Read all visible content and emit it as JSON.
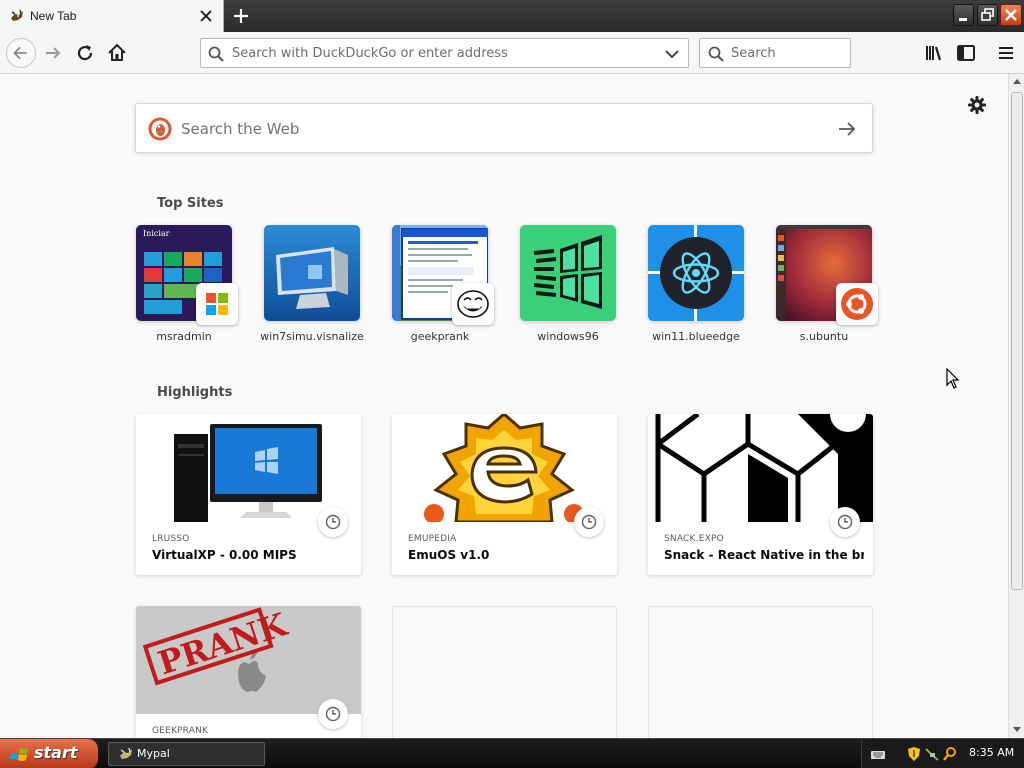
{
  "colors": {
    "accent": "#0a84ff",
    "titlebar": "#2a2a2a",
    "close_button": "#c4411b",
    "start_button": "#d2532d"
  },
  "tab": {
    "title": "New Tab",
    "favicon": "goat-favicon-icon"
  },
  "toolbar": {
    "url_placeholder": "Search with DuckDuckGo or enter address",
    "search_placeholder": "Search"
  },
  "newtab": {
    "web_search_placeholder": "Search the Web",
    "top_sites_title": "Top Sites",
    "highlights_title": "Highlights",
    "top_sites": [
      {
        "label": "msradmin",
        "icon": "windows8-start-screen-thumbnail"
      },
      {
        "label": "win7simu.visnalize",
        "icon": "windows7-computer-thumbnail"
      },
      {
        "label": "geekprank",
        "icon": "xp-desktop-thumbnail"
      },
      {
        "label": "windows96",
        "icon": "windows96-logo"
      },
      {
        "label": "win11.blueedge",
        "icon": "react-atom-logo"
      },
      {
        "label": "s.ubuntu",
        "icon": "ubuntu-desktop-thumbnail"
      }
    ],
    "highlights": [
      {
        "source": "LRUSSO",
        "title": "VirtualXP - 0.00 MIPS"
      },
      {
        "source": "EMUPEDIA",
        "title": "EmuOS v1.0"
      },
      {
        "source": "SNACK.EXPO",
        "title": "Snack - React Native in the bro..."
      },
      {
        "source": "GEEKPRANK",
        "title": "",
        "image_text": "PRANK"
      }
    ]
  },
  "taskbar": {
    "start_label": "start",
    "task_label": "Mypal",
    "clock": "8:35 AM"
  }
}
